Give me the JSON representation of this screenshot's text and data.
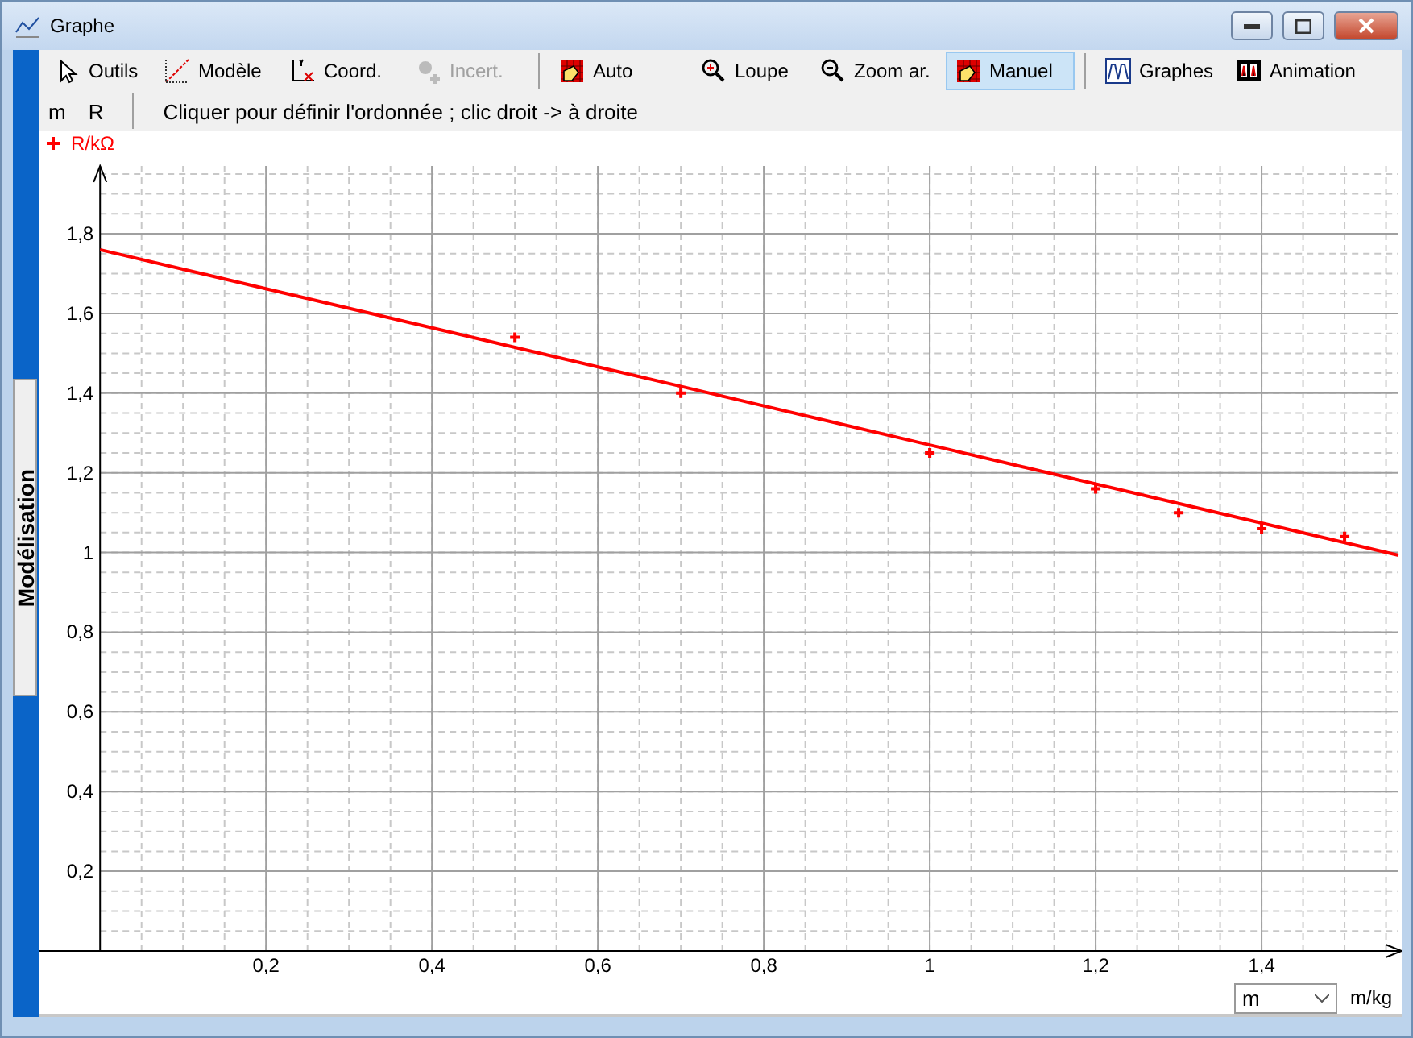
{
  "window": {
    "title": "Graphe"
  },
  "toolbar": [
    {
      "label": "Outils",
      "selected": false,
      "disabled": false
    },
    {
      "label": "Modèle",
      "selected": false,
      "disabled": false
    },
    {
      "label": "Coord.",
      "selected": false,
      "disabled": false
    },
    {
      "label": "Incert.",
      "selected": false,
      "disabled": true
    },
    {
      "label": "Auto",
      "selected": false,
      "disabled": false,
      "separator_before": true
    },
    {
      "label": "Loupe",
      "selected": false,
      "disabled": false
    },
    {
      "label": "Zoom ar.",
      "selected": false,
      "disabled": false
    },
    {
      "label": "Manuel",
      "selected": true,
      "disabled": false
    },
    {
      "label": "Graphes",
      "selected": false,
      "disabled": false,
      "separator_before": true
    },
    {
      "label": "Animation",
      "selected": false,
      "disabled": false
    }
  ],
  "variables": [
    "m",
    "R"
  ],
  "hint": "Cliquer pour définir l'ordonnée ; clic droit -> à droite",
  "side_tab": {
    "label": "Modélisation"
  },
  "chart": {
    "chart_data": {
      "type": "scatter",
      "xlabel": "m/kg",
      "xlim": [
        -0.074,
        1.565
      ],
      "ylim": [
        0,
        1.97
      ],
      "grid": true,
      "x": [
        0,
        0.5,
        0.7,
        1,
        1.2,
        1.3,
        1.4,
        1.5,
        1.565
      ],
      "series": [
        {
          "name": "R/kΩ",
          "color": "#ff0000",
          "values": [
            null,
            1.54,
            1.4,
            1.25,
            1.16,
            1.1,
            1.06,
            1.04,
            null
          ]
        },
        {
          "type": "line",
          "color": "#ff0000",
          "values": [
            1.76,
            1.515,
            1.417,
            1.27,
            1.172,
            1.123,
            1.074,
            1.025,
            0.993
          ]
        }
      ],
      "xticks": [
        {
          "value": 0.2,
          "label": "0,2"
        },
        {
          "value": 0.4,
          "label": "0,4"
        },
        {
          "value": 0.6,
          "label": "0,6"
        },
        {
          "value": 0.8,
          "label": "0,8"
        },
        {
          "value": 1,
          "label": "1"
        },
        {
          "value": 1.2,
          "label": "1,2"
        },
        {
          "value": 1.4,
          "label": "1,4"
        }
      ],
      "yticks": [
        {
          "value": 0.2,
          "label": "0,2"
        },
        {
          "value": 0.4,
          "label": "0,4"
        },
        {
          "value": 0.6,
          "label": "0,6"
        },
        {
          "value": 0.8,
          "label": "0,8"
        },
        {
          "value": 1,
          "label": "1"
        },
        {
          "value": 1.2,
          "label": "1,2"
        },
        {
          "value": 1.4,
          "label": "1,4"
        },
        {
          "value": 1.6,
          "label": "1,6"
        },
        {
          "value": 1.8,
          "label": "1,8"
        }
      ]
    }
  },
  "x_variable": {
    "value": "m"
  }
}
